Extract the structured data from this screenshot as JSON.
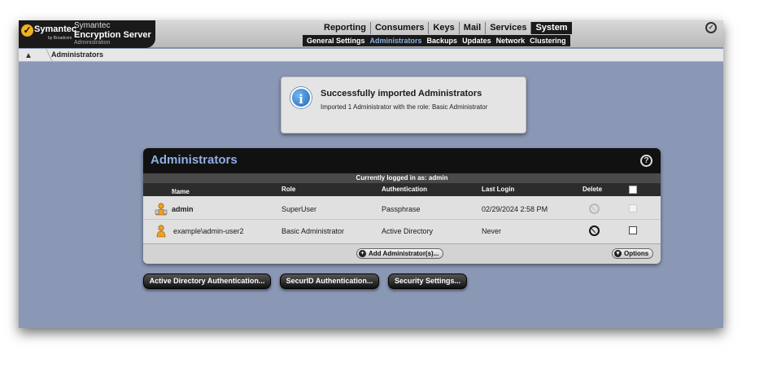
{
  "brand": {
    "logo_word": "Symantec",
    "logo_sub": "by Broadcom",
    "product_line1": "Symantec",
    "product_line2": "Encryption Server",
    "product_line3": "Administration"
  },
  "main_nav": [
    "Reporting",
    "Consumers",
    "Keys",
    "Mail",
    "Services",
    "System"
  ],
  "main_nav_active": "System",
  "sub_nav": [
    "General Settings",
    "Administrators",
    "Backups",
    "Updates",
    "Network",
    "Clustering"
  ],
  "sub_nav_active": "Administrators",
  "breadcrumb": {
    "current": "Administrators"
  },
  "notice": {
    "title": "Successfully imported Administrators",
    "body": "Imported 1 Administrator with the role: Basic Administrator"
  },
  "panel": {
    "title": "Administrators",
    "logged_in": "Currently logged in as: admin",
    "columns": {
      "name": "Name",
      "role": "Role",
      "authentication": "Authentication",
      "last_login": "Last Login",
      "delete": "Delete"
    },
    "rows": [
      {
        "name": "admin",
        "role": "SuperUser",
        "authentication": "Passphrase",
        "last_login": "02/29/2024 2:58 PM"
      },
      {
        "name": "example\\admin-user2",
        "role": "Basic Administrator",
        "authentication": "Active Directory",
        "last_login": "Never"
      }
    ],
    "add_button": "Add Administrator(s)...",
    "options_button": "Options"
  },
  "buttons": {
    "ad_auth": "Active Directory Authentication...",
    "securid_auth": "SecurID Authentication...",
    "security_settings": "Security Settings..."
  },
  "colors": {
    "background": "#8a97b5",
    "panel_title": "#8fb0e8",
    "logo_gold": "#f2b01e"
  }
}
